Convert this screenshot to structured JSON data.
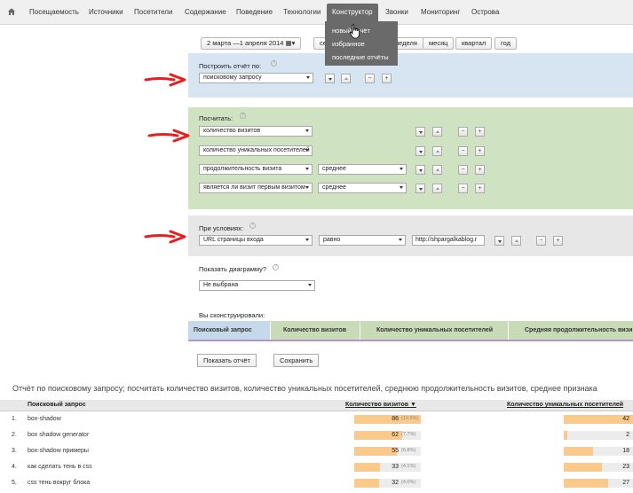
{
  "nav": {
    "items": [
      "Посещаемость",
      "Источники",
      "Посетители",
      "Содержание",
      "Поведение",
      "Технологии",
      "Конструктор",
      "Звонки",
      "Мониторинг",
      "Острова"
    ],
    "active": "Конструктор"
  },
  "menu": {
    "items": [
      "новый отчёт",
      "избранное",
      "последние отчёты"
    ]
  },
  "period": {
    "range": "2 марта —1 апреля 2014",
    "buttons": [
      "се",
      "неделя",
      "месяц",
      "квартал",
      "год"
    ]
  },
  "build": {
    "label": "Построить отчёт по:",
    "select": "поисковому запросу"
  },
  "calc": {
    "label": "Посчитать:",
    "rows": [
      {
        "metric": "количество визитов",
        "agg": ""
      },
      {
        "metric": "количество уникальных посетителей",
        "agg": ""
      },
      {
        "metric": "продолжительность визита",
        "agg": "среднее"
      },
      {
        "metric": "является ли визит первым визитом",
        "agg": "среднее"
      }
    ]
  },
  "cond": {
    "label": "При условиях:",
    "field": "URL страницы входа",
    "op": "равно",
    "value": "http://shpargalkablog.r"
  },
  "diagram": {
    "label": "Показать диаграмму?",
    "select": "Не выбрана"
  },
  "constructed": {
    "label": "Вы сконструировали:",
    "headers": [
      "Поисковый запрос",
      "Количество визитов",
      "Количество уникальных посетителей",
      "Средняя продолжительность визи"
    ]
  },
  "buttons": {
    "show": "Показать отчёт",
    "save": "Сохранить"
  },
  "report": {
    "title": "Отчёт по поисковому запросу; посчитать количество визитов, количество уникальных посетителей, среднюю продолжительность визитов, среднее признака",
    "col_query": "Поисковый запрос",
    "col_visits": "Количество визитов ▼",
    "col_unique": "Количество уникальных посетителей",
    "rows": [
      {
        "n": "1.",
        "q": "box-shadow",
        "visits": 86,
        "pct": "(10.5%)",
        "unique": 42
      },
      {
        "n": "2.",
        "q": "box shadow generator",
        "visits": 62,
        "pct": "(7.7%)",
        "unique": 2
      },
      {
        "n": "3.",
        "q": "box-shadow примеры",
        "visits": 55,
        "pct": "(6.8%)",
        "unique": 18
      },
      {
        "n": "4.",
        "q": "как сделать тень в css",
        "visits": 33,
        "pct": "(4.1%)",
        "unique": 23
      },
      {
        "n": "5.",
        "q": "css тень вокруг блока",
        "visits": 32,
        "pct": "(4.0%)",
        "unique": 27
      }
    ]
  },
  "colors": {
    "blue_panel": "#d6e5f1",
    "green_panel": "#cfe2c1",
    "grey_panel": "#e7e7e7",
    "bar": "#fac98c",
    "arrow": "#e81e1e"
  }
}
